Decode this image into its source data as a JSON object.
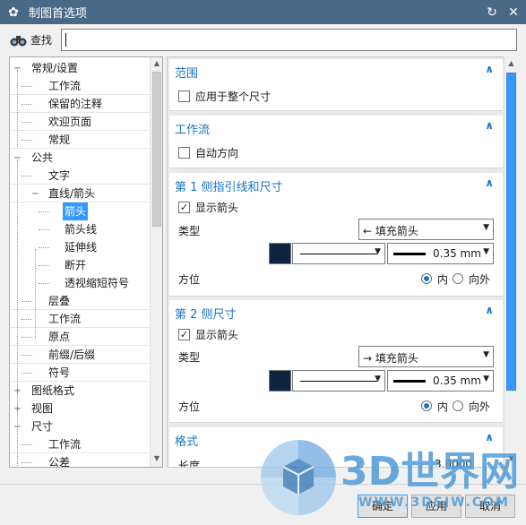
{
  "window": {
    "title": "制图首选项",
    "gear_icon": "gear-icon",
    "reset_icon": "reset-icon",
    "close_icon": "close-icon"
  },
  "search": {
    "label": "查找",
    "value": "",
    "icon": "binoculars-icon"
  },
  "tree": {
    "items": [
      {
        "label": "常规/设置",
        "level": 0,
        "expander": "minus"
      },
      {
        "label": "工作流",
        "level": 1
      },
      {
        "label": "保留的注释",
        "level": 1
      },
      {
        "label": "欢迎页面",
        "level": 1
      },
      {
        "label": "常规",
        "level": 1
      },
      {
        "label": "公共",
        "level": 0,
        "expander": "minus"
      },
      {
        "label": "文字",
        "level": 1
      },
      {
        "label": "直线/箭头",
        "level": 1,
        "expander": "minus"
      },
      {
        "label": "箭头",
        "level": 2,
        "selected": true
      },
      {
        "label": "箭头线",
        "level": 2
      },
      {
        "label": "延伸线",
        "level": 2
      },
      {
        "label": "断开",
        "level": 2
      },
      {
        "label": "透视缩短符号",
        "level": 2
      },
      {
        "label": "层叠",
        "level": 1
      },
      {
        "label": "工作流",
        "level": 1
      },
      {
        "label": "原点",
        "level": 1
      },
      {
        "label": "前缀/后缀",
        "level": 1
      },
      {
        "label": "符号",
        "level": 1
      },
      {
        "label": "图纸格式",
        "level": 0,
        "expander": "plus"
      },
      {
        "label": "视图",
        "level": 0,
        "expander": "plus"
      },
      {
        "label": "尺寸",
        "level": 0,
        "expander": "minus"
      },
      {
        "label": "工作流",
        "level": 1
      },
      {
        "label": "公差",
        "level": 1
      }
    ]
  },
  "sections": {
    "scope": {
      "title": "范围",
      "checkbox_label": "应用于整个尺寸",
      "checked": false
    },
    "workflow": {
      "title": "工作流",
      "checkbox_label": "自动方向",
      "checked": false
    },
    "side1": {
      "title": "第 1 侧指引线和尺寸",
      "show_arrow_label": "显示箭头",
      "show_arrow_checked": true,
      "type_label": "类型",
      "type_value": "填充箭头",
      "type_icon": "←",
      "line_weight": "0.35 mm",
      "orientation_label": "方位",
      "opt_inside": "内",
      "opt_outside": "向外",
      "selected": "内"
    },
    "side2": {
      "title": "第 2 侧尺寸",
      "show_arrow_label": "显示箭头",
      "show_arrow_checked": true,
      "type_label": "类型",
      "type_value": "填充箭头",
      "type_icon": "→",
      "line_weight": "0.35 mm",
      "orientation_label": "方位",
      "opt_inside": "内",
      "opt_outside": "向外",
      "selected": "内"
    },
    "format": {
      "title": "格式",
      "length_label": "长度",
      "length_value": "3.0000"
    }
  },
  "buttons": {
    "ok": "确定",
    "apply": "应用",
    "cancel": "取消"
  },
  "watermark": {
    "text": "3D世界网",
    "url": "WWW.3DSJW.COM"
  },
  "colors": {
    "titlebar": "#4a6986",
    "accent": "#1a73c6",
    "selection": "#3399ff",
    "swatch": "#0d2340"
  }
}
